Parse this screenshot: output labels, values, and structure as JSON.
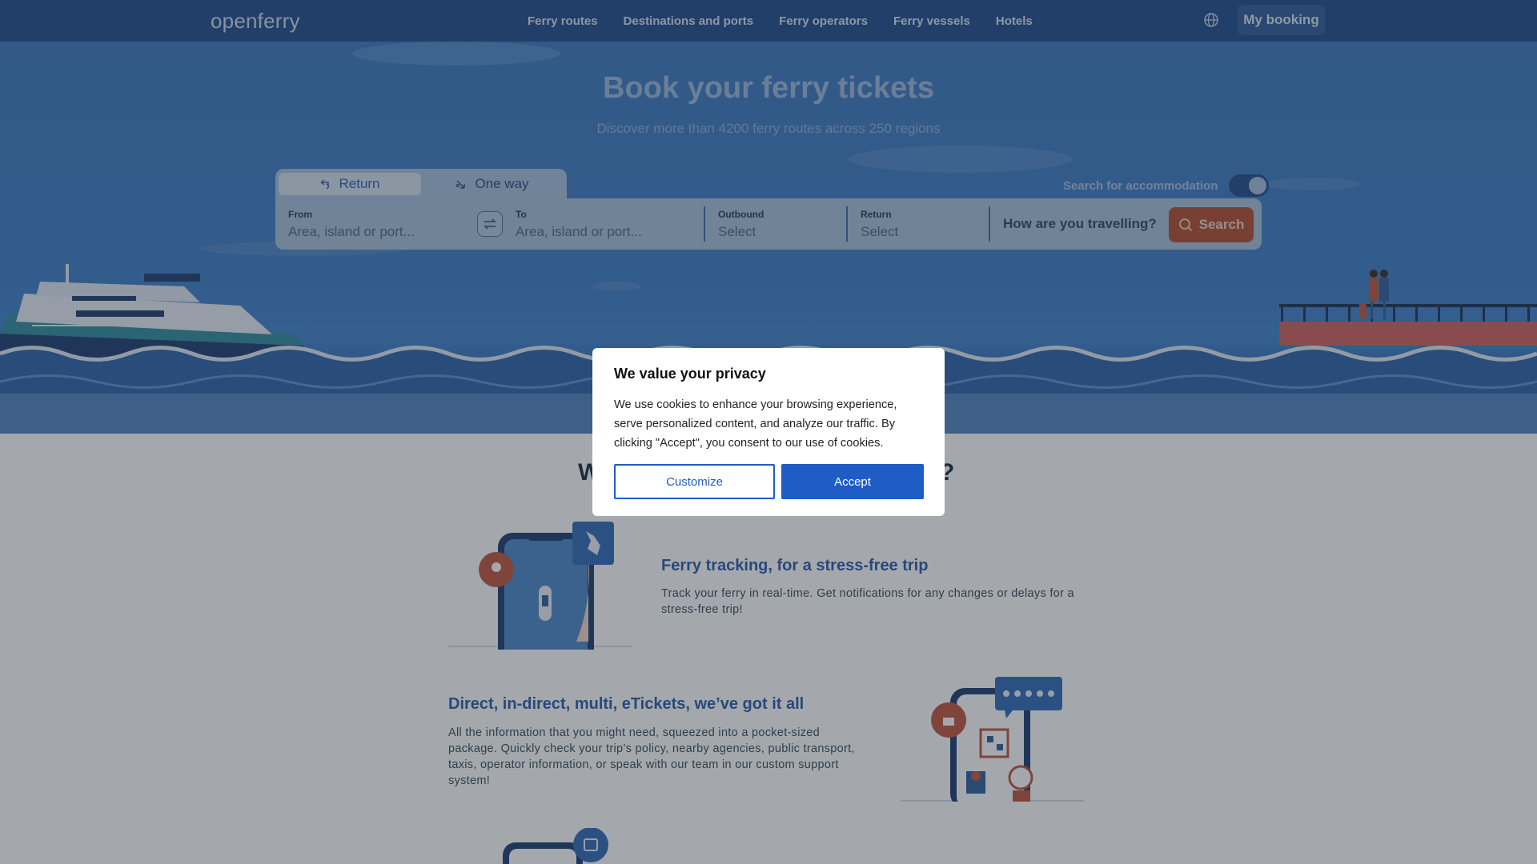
{
  "nav": {
    "logo": "openferry",
    "links": [
      "Ferry routes",
      "Destinations and ports",
      "Ferry operators",
      "Ferry vessels",
      "Hotels"
    ],
    "my_booking": "My booking",
    "globe_icon": "globe-icon"
  },
  "hero": {
    "title": "Book your ferry tickets",
    "subtitle": "Discover more than 4200 ferry routes across 250 regions"
  },
  "search": {
    "tabs": [
      {
        "label": "Return",
        "icon": "return-arrows-icon",
        "active": true
      },
      {
        "label": "One way",
        "icon": "one-way-arrow-icon",
        "active": false
      }
    ],
    "accommodation_label": "Search for accommodation",
    "accommodation_enabled": true,
    "from_label": "From",
    "from_placeholder": "Area, island or port...",
    "to_label": "To",
    "to_placeholder": "Area, island or port...",
    "outbound_label": "Outbound",
    "outbound_value": "Select",
    "return_label": "Return",
    "return_value": "Select",
    "travel_prompt": "How are you travelling?",
    "search_button": "Search"
  },
  "content": {
    "heading_start": "W",
    "heading_end": "?",
    "features": [
      {
        "title": "Ferry tracking, for a stress-free trip",
        "text": "Track your ferry in real-time. Get notifications for any changes or delays for a stress-free trip!"
      },
      {
        "title": "Direct, in-direct, multi, eTickets, we’ve got it all",
        "text": "All the information that you might need, squeezed into a pocket-sized package. Quickly check your trip’s policy, nearby agencies, public transport, taxis, operator information, or speak with our team in our custom support system!"
      }
    ]
  },
  "cookie": {
    "title": "We value your privacy",
    "text": "We use cookies to enhance your browsing experience, serve personalized content, and analyze our traffic. By clicking \"Accept\", you consent to our use of cookies.",
    "customize": "Customize",
    "accept": "Accept"
  },
  "colors": {
    "nav": "#1e4a8a",
    "accent": "#1f5cc6",
    "search_button": "#b44c2b",
    "feature_title": "#2a5ba7"
  }
}
